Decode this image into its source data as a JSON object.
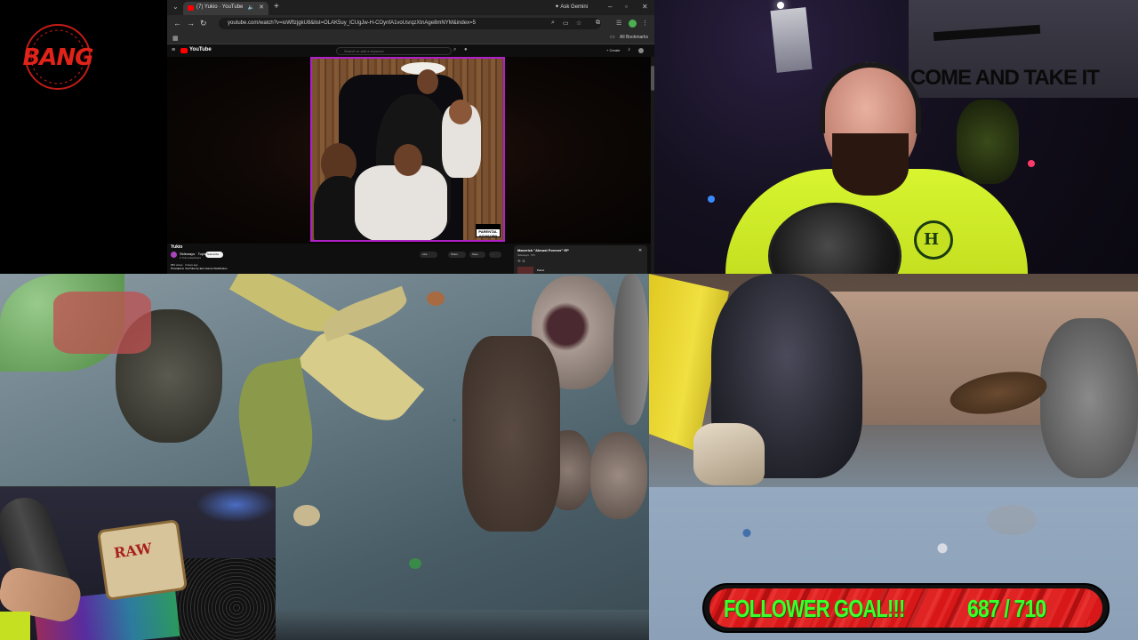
{
  "logo": {
    "text": "BANG",
    "color": "#e2231a"
  },
  "browser": {
    "tab_title": "(7) Yukio · YouTube",
    "gemini_label": "Ask Gemini",
    "url": "youtube.com/watch?v=ioWflzjgkU8&list=OLAK5uy_lCUgJw-H-COynfA1voUsrqzXtnAge8mNYM&index=5",
    "bookmarks_label": "All Bookmarks",
    "youtube": {
      "logo_text": "YouTube",
      "search_placeholder": "Search or add a keyword",
      "create_label": "+ Create",
      "video_title": "Yukio",
      "channel": "Sideways · Topic",
      "subscribers": "1.71K subscribers",
      "subscribe_label": "Subscribe",
      "actions": [
        "Like",
        "Share",
        "Save",
        "..."
      ],
      "description_line1": "883 views · 3 days ago",
      "description_line2": "Provided to YouTube by Eco Humor Distribution",
      "playlist_title": "Maverick \"Almost Forever\" EP",
      "playlist_sub": "Sideways · 5/5",
      "playlist_item": "Parrot",
      "explicit_label": "PARENTAL ADVISORY"
    }
  },
  "webcam": {
    "poster_text": "COME AND TAKE IT"
  },
  "deskcam": {
    "tray_brand": "RAW"
  },
  "follower_goal": {
    "label": "FOLLOWER GOAL!!!",
    "count_text": "687 / 710",
    "current": 687,
    "target": 710,
    "text_color": "#3dff2a",
    "bar_color": "#d81818"
  }
}
